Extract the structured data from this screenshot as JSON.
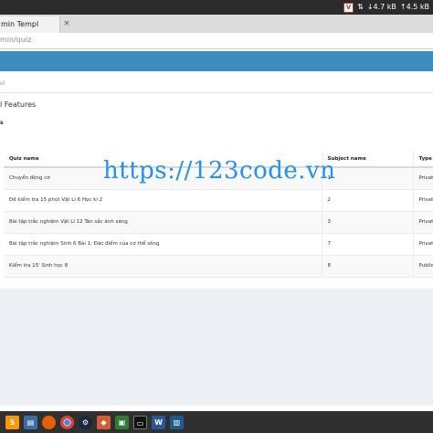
{
  "os_bar": {
    "tray_badge": "V",
    "sort_glyph": "⇅",
    "download_speed": "↓4.7 kB",
    "upload_speed": "↑4.5 kB"
  },
  "browser": {
    "tab_title": "min Templ",
    "tab_close": "×",
    "url": "min/quiz"
  },
  "breadcrumb": {
    "text": "el"
  },
  "box": {
    "title": "l Features",
    "subtitle": "s"
  },
  "table": {
    "headers": [
      "Quiz name",
      "Subject name",
      "Type"
    ],
    "rows": [
      [
        "Chuyển động cơ",
        "1",
        "Privat"
      ],
      [
        "Đề kiểm tra 15 phút Vật Lí 6 Học kì 2",
        "2",
        "Privat"
      ],
      [
        "Bài tập trắc nghiệm Vật Lí 12 Tán sắc ánh sáng",
        "3",
        "Privat"
      ],
      [
        "Bài tập trắc nghiệm Sinh 6 Bài 1: Đặc điểm của cơ thể sống",
        "7",
        "Privat"
      ],
      [
        "Kiểm tra 15' Sinh học 8",
        "8",
        "Public"
      ]
    ]
  },
  "watermark": "https://123code.vn",
  "taskbar": {
    "word_letter": "W"
  },
  "colors": {
    "navbar": "#3c8dbc",
    "content_bg": "#ecf0f5",
    "watermark": "#1e90ff",
    "taskbar": "#303030"
  }
}
